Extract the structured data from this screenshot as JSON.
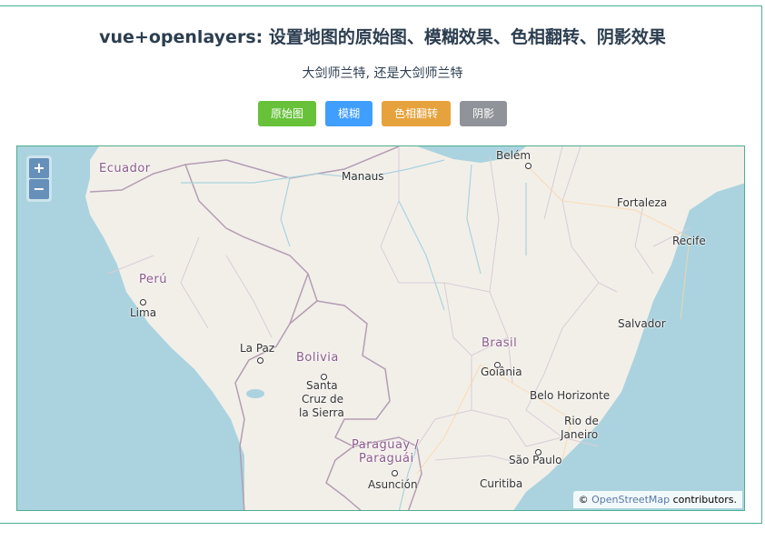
{
  "page": {
    "title": "vue+openlayers: 设置地图的原始图、模糊效果、色相翻转、阴影效果",
    "subtitle": "大剑师兰特, 还是大剑师兰特"
  },
  "buttons": [
    {
      "label": "原始图",
      "color": "#67c23a"
    },
    {
      "label": "模糊",
      "color": "#409eff"
    },
    {
      "label": "色相翻转",
      "color": "#e6a23c"
    },
    {
      "label": "阴影",
      "color": "#909399"
    }
  ],
  "map": {
    "zoom_in": "+",
    "zoom_out": "−",
    "attribution_prefix": "© ",
    "attribution_link": "OpenStreetMap",
    "attribution_suffix": " contributors.",
    "countries": [
      "Ecuador",
      "Perú",
      "Bolivia",
      "Brasil",
      "Paraguay /",
      "Paraguái"
    ],
    "cities": [
      "Belém",
      "Manaus",
      "Fortaleza",
      "Recife",
      "Lima",
      "Salvador",
      "La Paz",
      "Goiânia",
      "Santa",
      "Cruz de",
      "la Sierra",
      "Belo Horizonte",
      "Rio de",
      "Janeiro",
      "São Paulo",
      "Asunción",
      "Curitiba"
    ]
  }
}
